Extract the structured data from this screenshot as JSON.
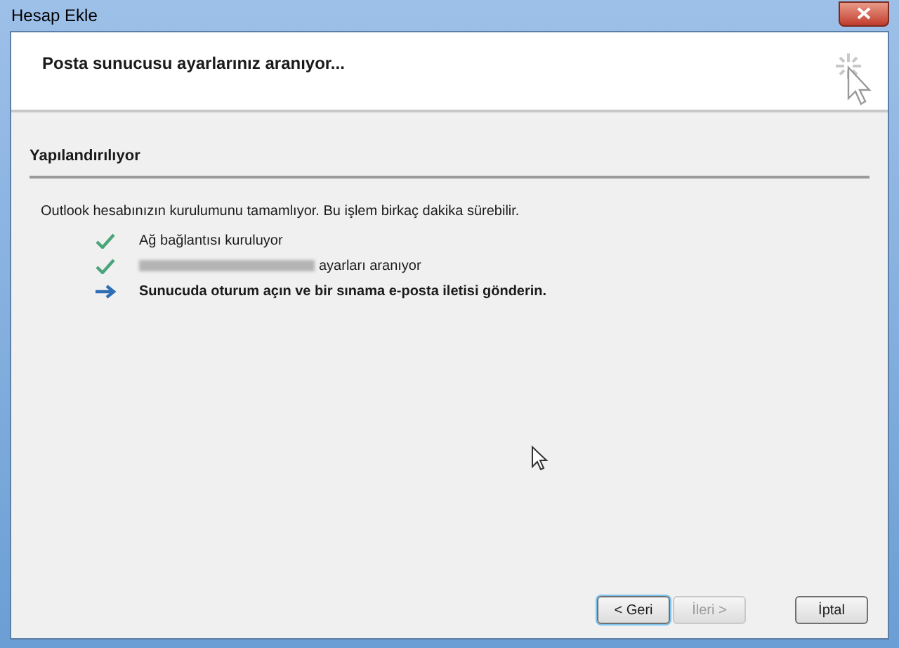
{
  "window": {
    "title": "Hesap Ekle"
  },
  "header": {
    "title": "Posta sunucusu ayarlarınız aranıyor..."
  },
  "section": {
    "title": "Yapılandırılıyor"
  },
  "description": "Outlook hesabınızın kurulumunu tamamlıyor. Bu işlem birkaç dakika sürebilir.",
  "steps": [
    {
      "kind": "done",
      "text": "Ağ bağlantısı kuruluyor",
      "redacted": false
    },
    {
      "kind": "done",
      "text": "ayarları aranıyor",
      "redacted": true
    },
    {
      "kind": "current",
      "text": "Sunucuda oturum açın ve bir sınama e-posta iletisi gönderin.",
      "redacted": false
    }
  ],
  "buttons": [
    {
      "label": "< Geri",
      "disabled": false,
      "focused": true
    },
    {
      "label": "İleri >",
      "disabled": true,
      "focused": false
    },
    {
      "label": "İptal",
      "disabled": false,
      "focused": false
    }
  ]
}
